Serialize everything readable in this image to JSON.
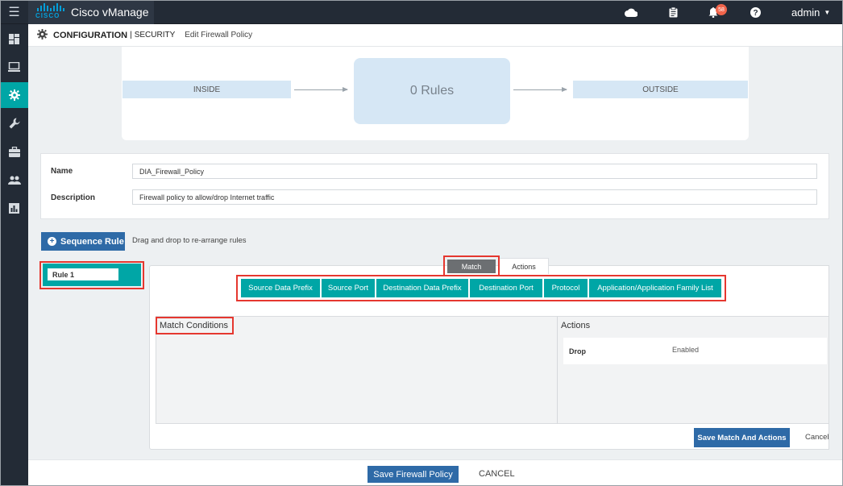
{
  "topbar": {
    "app_title": "Cisco vManage",
    "brand_wordmark": "CISCO",
    "notification_count": "58",
    "user": "admin"
  },
  "sidebar": {
    "items": [
      {
        "icon": "dashboard-icon"
      },
      {
        "icon": "monitor-icon"
      },
      {
        "icon": "gear-icon",
        "active": true
      },
      {
        "icon": "wrench-icon"
      },
      {
        "icon": "briefcase-icon"
      },
      {
        "icon": "users-icon"
      },
      {
        "icon": "analytics-icon"
      }
    ]
  },
  "header": {
    "section": "CONFIGURATION",
    "separator": "|",
    "subsection": "SECURITY",
    "page": "Edit Firewall Policy"
  },
  "flow": {
    "source_zone": "INSIDE",
    "rules_label": "0 Rules",
    "destination_zone": "OUTSIDE"
  },
  "form": {
    "name_label": "Name",
    "name_value": "DIA_Firewall_Policy",
    "description_label": "Description",
    "description_value": "Firewall policy to allow/drop Internet traffic"
  },
  "sequence": {
    "add_button": "Sequence Rule",
    "hint": "Drag and drop to re-arrange rules",
    "rules": [
      {
        "name": "Rule 1"
      }
    ]
  },
  "tabs": {
    "match": "Match",
    "actions": "Actions"
  },
  "match_buttons": [
    "Source Data Prefix",
    "Source Port",
    "Destination Data Prefix",
    "Destination Port",
    "Protocol",
    "Application/Application Family List"
  ],
  "conditions": {
    "title": "Match Conditions"
  },
  "actions": {
    "title": "Actions",
    "rows": [
      {
        "label": "Drop",
        "value": "Enabled"
      }
    ]
  },
  "buttons": {
    "save_match_actions": "Save Match And Actions",
    "cancel_match": "Cancel",
    "save_policy": "Save Firewall Policy",
    "cancel_policy": "CANCEL"
  },
  "colors": {
    "accent_teal": "#00a6a6",
    "primary_blue": "#2e6aa7",
    "nav_dark": "#232b36",
    "highlight_red": "#e5372f",
    "badge_orange": "#f0644b"
  }
}
